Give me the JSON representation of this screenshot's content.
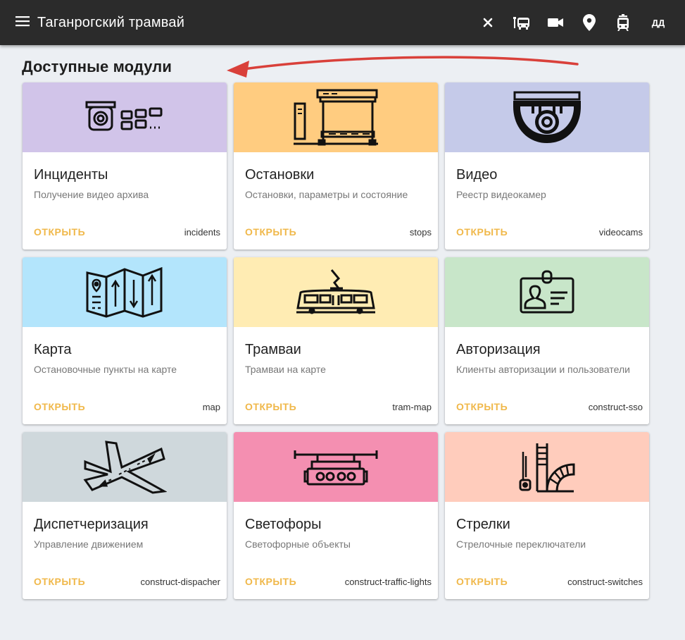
{
  "header": {
    "app_title": "Таганрогский трамвай",
    "icons": [
      "menu-icon",
      "close-icon",
      "tram-stop-icon",
      "video-camera-icon",
      "map-pin-icon",
      "tram-icon"
    ],
    "user_initials": "ДД",
    "background": "#2b2b2b"
  },
  "main": {
    "section_title": "Доступные модули",
    "open_label": "ОТКРЫТЬ",
    "accent_color": "#f0b84a",
    "annotation_arrow_color": "#d9403a"
  },
  "modules": [
    {
      "title": "Инциденты",
      "subtitle": "Получение видео архива",
      "code": "incidents",
      "media_color": "#d1c4e9",
      "icon": "incidents-camera-icon"
    },
    {
      "title": "Остановки",
      "subtitle": "Остановки, параметры и состояние",
      "code": "stops",
      "media_color": "#ffcc80",
      "icon": "bus-stop-icon"
    },
    {
      "title": "Видео",
      "subtitle": "Реестр видеокамер",
      "code": "videocams",
      "media_color": "#c5cae9",
      "icon": "dome-camera-icon"
    },
    {
      "title": "Карта",
      "subtitle": "Остановочные пункты на карте",
      "code": "map",
      "media_color": "#b3e5fc",
      "icon": "folded-map-icon"
    },
    {
      "title": "Трамваи",
      "subtitle": "Трамваи на карте",
      "code": "tram-map",
      "media_color": "#ffecb3",
      "icon": "tram-icon"
    },
    {
      "title": "Авторизация",
      "subtitle": "Клиенты авторизации и пользователи",
      "code": "construct-sso",
      "media_color": "#c8e6c9",
      "icon": "id-badge-icon"
    },
    {
      "title": "Диспетчеризация",
      "subtitle": "Управление движением",
      "code": "construct-dispacher",
      "media_color": "#cfd8dc",
      "icon": "crossroads-icon"
    },
    {
      "title": "Светофоры",
      "subtitle": "Светофорные объекты",
      "code": "construct-traffic-lights",
      "media_color": "#f48fb1",
      "icon": "traffic-light-icon"
    },
    {
      "title": "Стрелки",
      "subtitle": "Стрелочные переключатели",
      "code": "construct-switches",
      "media_color": "#ffccbc",
      "icon": "rail-switch-icon"
    }
  ]
}
